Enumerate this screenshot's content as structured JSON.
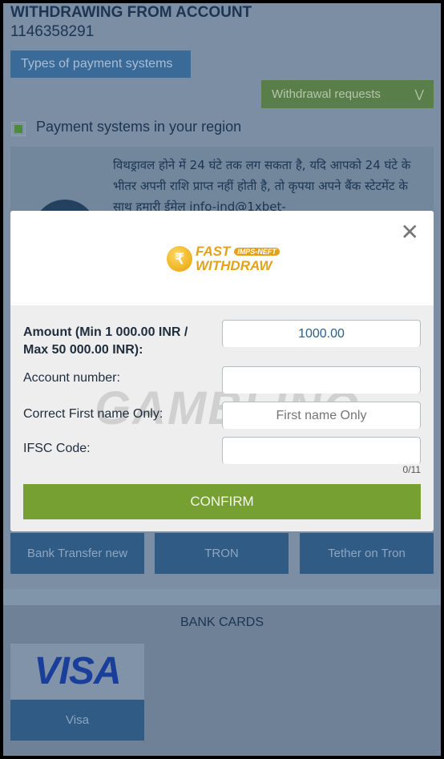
{
  "header": {
    "title": "WITHDRAWING FROM ACCOUNT",
    "account": "1146358291"
  },
  "types_button": "Types of payment systems",
  "withdrawal_requests": {
    "label": "Withdrawal requests",
    "icon": "double-chevron-down-icon"
  },
  "region_checkbox": {
    "label": "Payment systems in your region",
    "checked": true,
    "color": "#4d8a3a"
  },
  "info_text": "विथड्रावल होने में 24 घंटे तक लग सकता है, यदि आपको 24 घंटे के भीतर अपनी राशि प्राप्त नहीं होती है, तो कृपया अपने बैंक स्टेटमेंट के साथ हमारी ईमेल info-ind@1xbet-",
  "modal": {
    "logo": {
      "line1": "FAST",
      "badge": "IMPS-NEFT",
      "line2": "WITHDRAW"
    },
    "close_icon": "close-icon",
    "fields": [
      {
        "label": "Amount (Min 1 000.00 INR / Max 50 000.00 INR):",
        "value": "1000.00",
        "placeholder": ""
      },
      {
        "label": "Account number:",
        "value": "",
        "placeholder": ""
      },
      {
        "label": "Correct First name Only:",
        "value": "",
        "placeholder": "First name Only"
      },
      {
        "label": "IFSC Code:",
        "value": "",
        "placeholder": ""
      }
    ],
    "ifsc_counter": "0/11",
    "confirm": "CONFIRM",
    "watermark": "GAMBLINO"
  },
  "payment_methods": [
    "Bank Transfer new",
    "TRON",
    "Tether on Tron"
  ],
  "bank_cards": {
    "title": "BANK CARDS",
    "items": [
      {
        "logo": "VISA",
        "label": "Visa"
      }
    ]
  },
  "colors": {
    "overlay": "#7b8ea3",
    "confirm": "#76a031",
    "tile": "#2f5b85",
    "green_button": "#5a7e4a"
  }
}
